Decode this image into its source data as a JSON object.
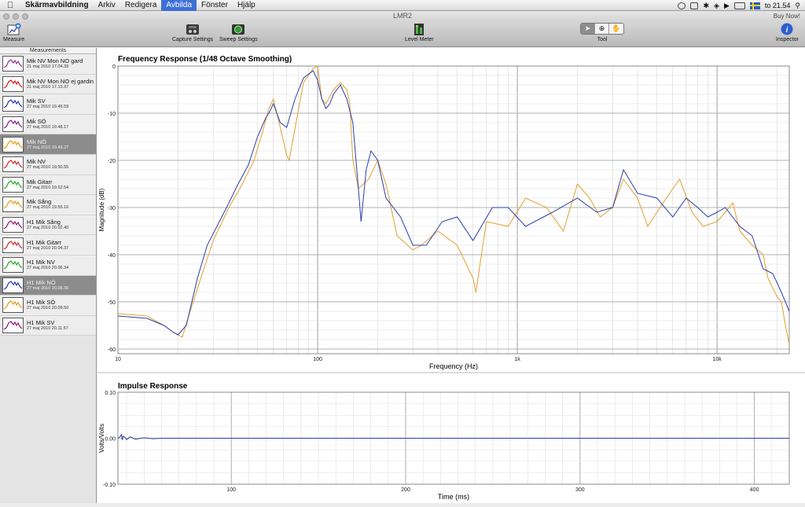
{
  "menubar": {
    "app_name": "Skärmavbildning",
    "items": [
      "Arkiv",
      "Redigera",
      "Avbilda",
      "Fönster",
      "Hjälp"
    ],
    "active_item": "Avbilda",
    "clock": "to 21.54"
  },
  "window": {
    "title": "LMR2",
    "buy_now": "Buy Now!"
  },
  "toolbar": {
    "measure": "Measure",
    "capture_settings": "Capture Settings",
    "sweep_settings": "Sweep Settings",
    "level_meter": "Level Meter",
    "tool": "Tool",
    "inspector": "Inspector"
  },
  "sidebar": {
    "header": "Measurements",
    "items": [
      {
        "name": "Mik NV Mon NO gard",
        "date": "21 maj 2010 17.04.39",
        "color": "#9a3d8a",
        "selected": false
      },
      {
        "name": "Mik NV Mon NO ej gardin",
        "date": "21 maj 2010 17.13.37",
        "color": "#e02020",
        "selected": false
      },
      {
        "name": "Mik SV",
        "date": "27 maj 2010 19.46.59",
        "color": "#2a40c8",
        "selected": false
      },
      {
        "name": "Mik SÖ",
        "date": "27 maj 2010 19.48.17",
        "color": "#8a2a8a",
        "selected": false
      },
      {
        "name": "Mik NÖ",
        "date": "27 maj 2010 19.49.27",
        "color": "#e8a020",
        "selected": true
      },
      {
        "name": "Mik NV",
        "date": "27 maj 2010 19.50.55",
        "color": "#d83030",
        "selected": false
      },
      {
        "name": "Mik Gitarr",
        "date": "27 maj 2010 19.52.54",
        "color": "#30b030",
        "selected": false
      },
      {
        "name": "Mik Sång",
        "date": "27 maj 2010 19.55.16",
        "color": "#e8a020",
        "selected": false
      },
      {
        "name": "H1 Mik Sång",
        "date": "27 maj 2010 20.02.40",
        "color": "#a02080",
        "selected": false
      },
      {
        "name": "H1 Mik Gitarr",
        "date": "27 maj 2010 20.04.37",
        "color": "#d03030",
        "selected": false
      },
      {
        "name": "H1 Mik NV",
        "date": "27 maj 2010 20.06.34",
        "color": "#30b030",
        "selected": false
      },
      {
        "name": "H1 Mik NÖ",
        "date": "27 maj 2010 20.08.36",
        "color": "#2a40c8",
        "selected": true
      },
      {
        "name": "H1 Mik SÖ",
        "date": "27 maj 2010 20.09.50",
        "color": "#e8a020",
        "selected": false
      },
      {
        "name": "H1 Mik SV",
        "date": "27 maj 2010 20.11.57",
        "color": "#a02080",
        "selected": false
      }
    ]
  },
  "chart_data": [
    {
      "type": "line",
      "title": "Frequency Response (1/48 Octave Smoothing)",
      "xlabel": "Frequency (Hz)",
      "ylabel": "Magnitude (dB)",
      "x_scale": "log",
      "xlim": [
        10,
        23000
      ],
      "ylim": [
        -61,
        0
      ],
      "x_ticks": [
        {
          "v": 10,
          "label": "10"
        },
        {
          "v": 100,
          "label": "100"
        },
        {
          "v": 1000,
          "label": "1k"
        },
        {
          "v": 10000,
          "label": "10k"
        }
      ],
      "y_ticks": [
        0,
        -10,
        -20,
        -30,
        -40,
        -50,
        -60
      ],
      "grid": true,
      "series": [
        {
          "color": "#2b3fa8",
          "points": [
            [
              10,
              -53
            ],
            [
              14,
              -53.5
            ],
            [
              17,
              -55
            ],
            [
              19,
              -56.5
            ],
            [
              20,
              -57
            ],
            [
              22,
              -55
            ],
            [
              25,
              -45
            ],
            [
              28,
              -38
            ],
            [
              35,
              -30
            ],
            [
              40,
              -25
            ],
            [
              45,
              -21
            ],
            [
              50,
              -15
            ],
            [
              55,
              -11
            ],
            [
              57,
              -10
            ],
            [
              60,
              -8
            ],
            [
              65,
              -12
            ],
            [
              70,
              -13
            ],
            [
              77,
              -7
            ],
            [
              85,
              -2.5
            ],
            [
              95,
              -1
            ],
            [
              100,
              -3
            ],
            [
              105,
              -7
            ],
            [
              110,
              -9
            ],
            [
              115,
              -8
            ],
            [
              120,
              -6
            ],
            [
              130,
              -4
            ],
            [
              140,
              -7
            ],
            [
              150,
              -12
            ],
            [
              160,
              -26
            ],
            [
              165,
              -33
            ],
            [
              175,
              -22
            ],
            [
              185,
              -18
            ],
            [
              200,
              -20
            ],
            [
              220,
              -28
            ],
            [
              260,
              -32
            ],
            [
              300,
              -38
            ],
            [
              350,
              -38
            ],
            [
              420,
              -33
            ],
            [
              500,
              -32
            ],
            [
              600,
              -37
            ],
            [
              750,
              -30
            ],
            [
              900,
              -30
            ],
            [
              1100,
              -34
            ],
            [
              1500,
              -31
            ],
            [
              2000,
              -28
            ],
            [
              2500,
              -31
            ],
            [
              3000,
              -30
            ],
            [
              3400,
              -22
            ],
            [
              4000,
              -27
            ],
            [
              5000,
              -28
            ],
            [
              6000,
              -32
            ],
            [
              7000,
              -28
            ],
            [
              8000,
              -30
            ],
            [
              9000,
              -32
            ],
            [
              10000,
              -31
            ],
            [
              11000,
              -30
            ],
            [
              13000,
              -34
            ],
            [
              15000,
              -36
            ],
            [
              17000,
              -43
            ],
            [
              19000,
              -44
            ],
            [
              20000,
              -46
            ],
            [
              21000,
              -48
            ],
            [
              22000,
              -50
            ],
            [
              23000,
              -52
            ]
          ]
        },
        {
          "color": "#e0a030",
          "points": [
            [
              10,
              -52.5
            ],
            [
              14,
              -53
            ],
            [
              17,
              -55
            ],
            [
              19,
              -56.5
            ],
            [
              21,
              -57.5
            ],
            [
              23,
              -52
            ],
            [
              26,
              -45
            ],
            [
              30,
              -37
            ],
            [
              36,
              -30
            ],
            [
              42,
              -25
            ],
            [
              48,
              -20
            ],
            [
              53,
              -14
            ],
            [
              57,
              -9
            ],
            [
              60,
              -7
            ],
            [
              65,
              -13
            ],
            [
              70,
              -19
            ],
            [
              72,
              -20
            ],
            [
              78,
              -12
            ],
            [
              85,
              -3.5
            ],
            [
              95,
              -0.5
            ],
            [
              100,
              0
            ],
            [
              105,
              -7
            ],
            [
              110,
              -8
            ],
            [
              120,
              -5
            ],
            [
              130,
              -3.5
            ],
            [
              140,
              -5
            ],
            [
              145,
              -8
            ],
            [
              150,
              -20
            ],
            [
              160,
              -26
            ],
            [
              180,
              -24
            ],
            [
              200,
              -20
            ],
            [
              220,
              -25
            ],
            [
              250,
              -36
            ],
            [
              300,
              -39
            ],
            [
              330,
              -38
            ],
            [
              400,
              -35
            ],
            [
              500,
              -38
            ],
            [
              600,
              -45
            ],
            [
              620,
              -48
            ],
            [
              700,
              -33
            ],
            [
              900,
              -34
            ],
            [
              1100,
              -28
            ],
            [
              1400,
              -30
            ],
            [
              1700,
              -35
            ],
            [
              2000,
              -25
            ],
            [
              2300,
              -28
            ],
            [
              2600,
              -32
            ],
            [
              3000,
              -30
            ],
            [
              3400,
              -24
            ],
            [
              4000,
              -28
            ],
            [
              4500,
              -34
            ],
            [
              5000,
              -31
            ],
            [
              6000,
              -26
            ],
            [
              6500,
              -24
            ],
            [
              7500,
              -31
            ],
            [
              8500,
              -34
            ],
            [
              10000,
              -33
            ],
            [
              11000,
              -31
            ],
            [
              12000,
              -29
            ],
            [
              13000,
              -35
            ],
            [
              15000,
              -38
            ],
            [
              17000,
              -40
            ],
            [
              18000,
              -45
            ],
            [
              20000,
              -49
            ],
            [
              21000,
              -50
            ],
            [
              22000,
              -55
            ],
            [
              23000,
              -59
            ]
          ]
        }
      ]
    },
    {
      "type": "line",
      "title": "Impulse Response",
      "xlabel": "Time (ms)",
      "ylabel": "Volts/Volts",
      "xlim": [
        35,
        420
      ],
      "ylim": [
        -0.1,
        0.1
      ],
      "x_ticks": [
        {
          "v": 100,
          "label": "100"
        },
        {
          "v": 200,
          "label": "200"
        },
        {
          "v": 300,
          "label": "300"
        },
        {
          "v": 400,
          "label": "400"
        }
      ],
      "y_ticks": [
        {
          "v": 0.1,
          "label": "0.10"
        },
        {
          "v": 0,
          "label": "0.00"
        },
        {
          "v": -0.1,
          "label": "-0.10"
        }
      ],
      "grid": true,
      "series": [
        {
          "color": "#2b3fa8",
          "points": [
            [
              35,
              0
            ],
            [
              36,
              0.002
            ],
            [
              37,
              0.008
            ],
            [
              37.5,
              -0.004
            ],
            [
              38,
              0.005
            ],
            [
              39,
              0.002
            ],
            [
              40,
              -0.003
            ],
            [
              42,
              0.003
            ],
            [
              45,
              -0.002
            ],
            [
              50,
              0.001
            ],
            [
              55,
              -0.001
            ],
            [
              60,
              0
            ],
            [
              420,
              0
            ]
          ]
        }
      ]
    }
  ]
}
